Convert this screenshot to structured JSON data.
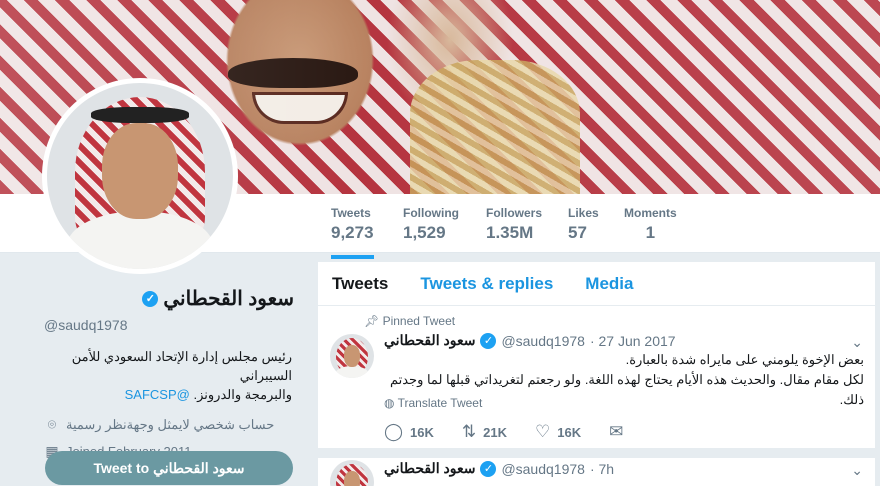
{
  "profile": {
    "name": "سعود القحطاني",
    "handle": "@saudq1978",
    "bio_line1": "رئيس مجلس إدارة الإتحاد السعودي للأمن السيبراني",
    "bio_line2": "والبرمجة والدرونز.",
    "bio_link": "@SAFCSP",
    "location": "حساب شخصي لايمثل وجهةنظر رسمية",
    "joined": "Joined February 2011",
    "tweet_to_button": "Tweet to سعود القحطاني"
  },
  "stats": [
    {
      "label": "Tweets",
      "value": "9,273"
    },
    {
      "label": "Following",
      "value": "1,529"
    },
    {
      "label": "Followers",
      "value": "1.35M"
    },
    {
      "label": "Likes",
      "value": "57"
    },
    {
      "label": "Moments",
      "value": "1"
    }
  ],
  "tabs": [
    {
      "label": "Tweets"
    },
    {
      "label": "Tweets & replies"
    },
    {
      "label": "Media"
    }
  ],
  "tweets": [
    {
      "pinned_label": "Pinned Tweet",
      "name": "سعود القحطاني",
      "handle": "@saudq1978",
      "date": "· 27 Jun 2017",
      "text1": "بعض الإخوة يلومني على مايراه شدة بالعبارة.",
      "text2": "لكل مقام مقال. والحديث هذه الأيام يحتاج لهذه اللغة. ولو رجعتم لتغريداتي قبلها لما وجدتم ذلك.",
      "translate": "Translate Tweet",
      "replies": "16K",
      "retweets": "21K",
      "likes": "16K"
    },
    {
      "name": "سعود القحطاني",
      "handle": "@saudq1978",
      "date": "· 7h"
    }
  ],
  "icons": {
    "verified": "verified-badge-icon",
    "location": "location-pin-icon",
    "calendar": "calendar-icon",
    "pin": "pin-icon",
    "globe": "globe-icon",
    "reply": "reply-icon",
    "retweet": "retweet-icon",
    "like": "heart-icon",
    "dm": "envelope-icon",
    "chevron": "chevron-down-icon"
  },
  "colors": {
    "accent": "#1da1f2",
    "link": "#1b95e0",
    "button": "#6b99a2",
    "background": "#e6ecf0"
  }
}
